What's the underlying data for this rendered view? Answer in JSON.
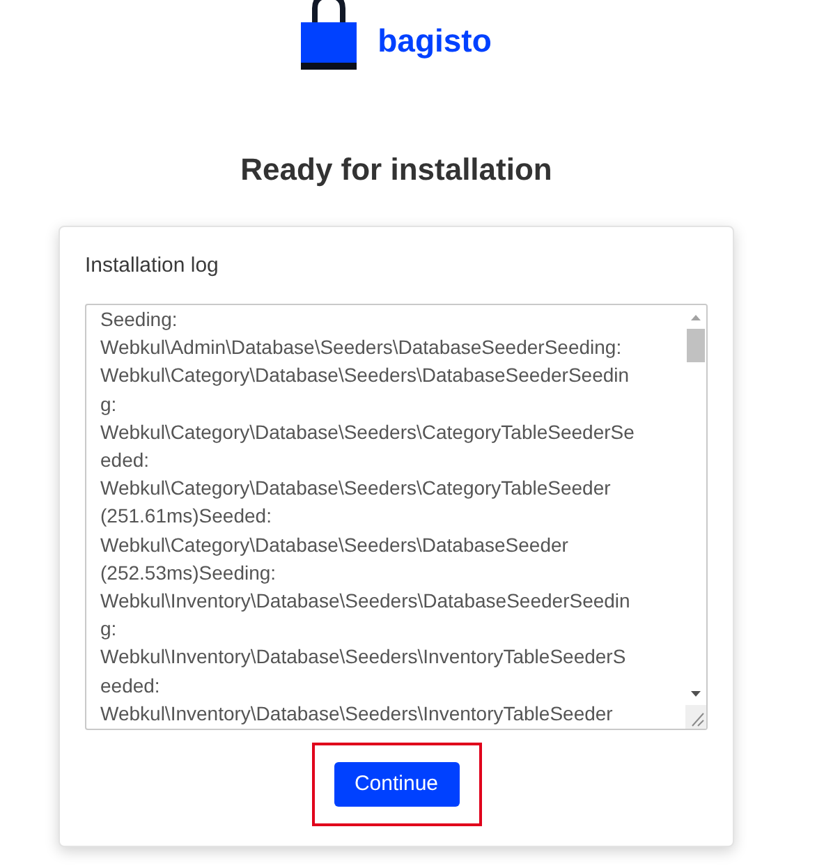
{
  "logo": {
    "name": "bagisto"
  },
  "title": "Ready for installation",
  "log": {
    "label": "Installation log",
    "lines": [
      "Seeding:",
      "Webkul\\Admin\\Database\\Seeders\\DatabaseSeederSeeding:",
      "Webkul\\Category\\Database\\Seeders\\DatabaseSeederSeedin",
      "g:",
      "Webkul\\Category\\Database\\Seeders\\CategoryTableSeederSe",
      "eded:",
      "Webkul\\Category\\Database\\Seeders\\CategoryTableSeeder",
      "(251.61ms)Seeded:",
      "Webkul\\Category\\Database\\Seeders\\DatabaseSeeder",
      "(252.53ms)Seeding:",
      "Webkul\\Inventory\\Database\\Seeders\\DatabaseSeederSeedin",
      "g:",
      "Webkul\\Inventory\\Database\\Seeders\\InventoryTableSeederS",
      "eeded:",
      "Webkul\\Inventory\\Database\\Seeders\\InventoryTableSeeder"
    ]
  },
  "continue_button": {
    "label": "Continue",
    "highlighted": true
  }
}
